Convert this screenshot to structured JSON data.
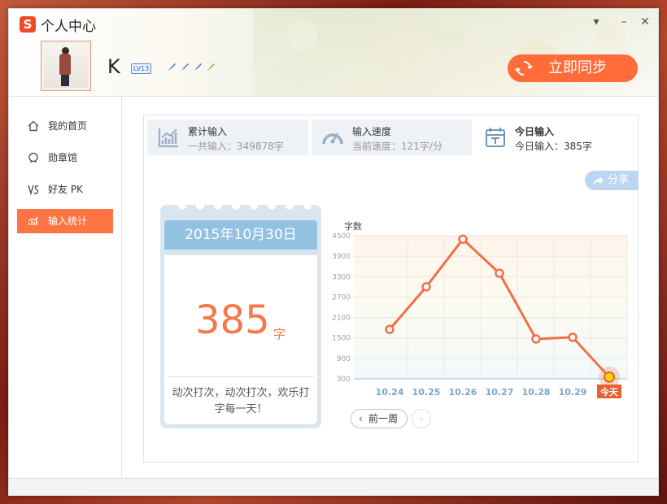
{
  "window": {
    "title": "个人中心",
    "logo_text": "S",
    "controls": {
      "menu": "▾",
      "minimize": "–",
      "close": "✕"
    }
  },
  "user": {
    "name": "K",
    "level": "LV13",
    "sync_label": "立即同步"
  },
  "sidebar": {
    "items": [
      {
        "label": "我的首页",
        "icon": "home-icon",
        "active": false
      },
      {
        "label": "勋章馆",
        "icon": "medal-icon",
        "active": false
      },
      {
        "label": "好友 PK",
        "icon": "vs-icon",
        "active": false
      },
      {
        "label": "输入统计",
        "icon": "chart-icon",
        "active": true
      }
    ]
  },
  "stats": [
    {
      "title": "累计输入",
      "value": "一共输入：349878字",
      "icon": "cumulative-chart-icon"
    },
    {
      "title": "输入速度",
      "value": "当前速度：121字/分",
      "icon": "speedometer-icon"
    },
    {
      "title": "今日输入",
      "value": "今日输入：385字",
      "icon": "calendar-today-icon"
    }
  ],
  "share_label": "分享",
  "calendar": {
    "date": "2015年10月30日",
    "count": "385",
    "unit": "字",
    "message": "动次打次，动次打次，欢乐打字每一天！"
  },
  "chart_data": {
    "type": "line",
    "ylabel": "字数",
    "yticks": [
      300,
      900,
      1500,
      2100,
      2700,
      3300,
      3900,
      4500
    ],
    "ylim": [
      300,
      4500
    ],
    "categories": [
      "10.24",
      "10.25",
      "10.26",
      "10.27",
      "10.28",
      "10.29",
      "今天"
    ],
    "values": [
      1750,
      3000,
      4400,
      3400,
      1470,
      1520,
      350
    ],
    "line_color": "#f07048",
    "highlight_color": "#e86030"
  },
  "nav": {
    "prev_week": "前一周",
    "prev_chevron": "‹",
    "next_chevron": "›"
  },
  "colors": {
    "accent": "#ff7443",
    "sync_button": "#ff6c3a",
    "calendar_head": "#93c2e0",
    "share": "#bcd6f1"
  }
}
